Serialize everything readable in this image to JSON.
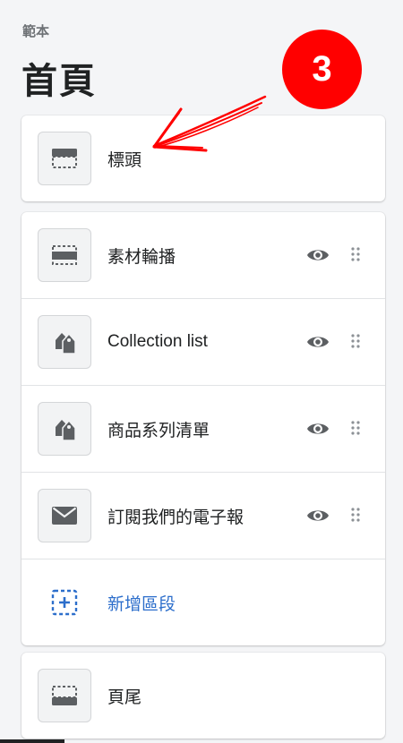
{
  "header": {
    "subtitle": "範本",
    "title": "首頁"
  },
  "annotation": {
    "step_number": "3",
    "color": "#ff0000"
  },
  "header_section": {
    "label": "標頭",
    "icon": "header-layout-icon"
  },
  "sections": [
    {
      "label": "素材輪播",
      "icon": "slideshow-icon",
      "visible": true
    },
    {
      "label": "Collection list",
      "icon": "tag-icon",
      "visible": true
    },
    {
      "label": "商品系列清單",
      "icon": "tag-icon",
      "visible": true
    },
    {
      "label": "訂閱我們的電子報",
      "icon": "envelope-icon",
      "visible": true
    }
  ],
  "add_section": {
    "label": "新增區段",
    "icon": "add-section-icon",
    "color": "#2c6ecb"
  },
  "footer_section": {
    "label": "頁尾",
    "icon": "footer-layout-icon"
  }
}
